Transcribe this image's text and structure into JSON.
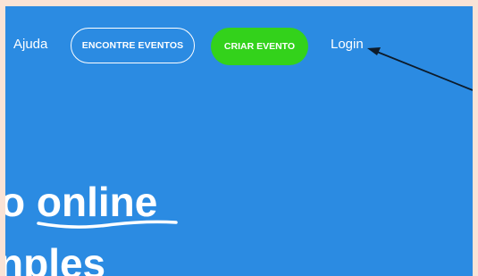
{
  "nav": {
    "help_label": "Ajuda",
    "find_events_label": "ENCONTRE EVENTOS",
    "create_event_label": "CRIAR EVENTO",
    "login_label": "Login"
  },
  "hero": {
    "line1_prefix": "o ",
    "line1_highlight": "online",
    "line2": "nples"
  },
  "colors": {
    "page_background": "#f9e3d6",
    "panel_background": "#2b8be2",
    "create_button": "#33d21b",
    "text": "#ffffff",
    "arrow": "#0d1b2a"
  }
}
